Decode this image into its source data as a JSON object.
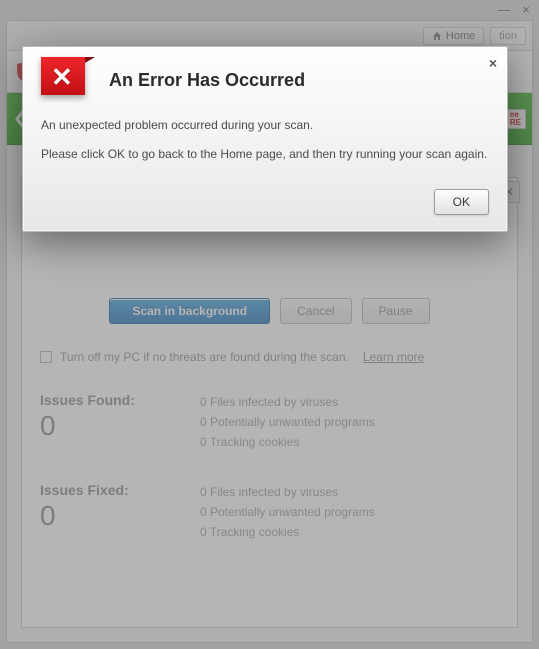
{
  "window": {
    "home_label": "Home",
    "tab_stub": "tion"
  },
  "greenbar": {
    "badge_line1": "ee",
    "badge_line2": "RE"
  },
  "scan_buttons": {
    "primary": "Scan in background",
    "cancel": "Cancel",
    "pause": "Pause"
  },
  "shutdown_row": {
    "label": "Turn off my PC if no threats are found during the scan.",
    "learn": "Learn more"
  },
  "found": {
    "title": "Issues Found:",
    "count": "0",
    "lines": [
      "0 Files infected by viruses",
      "0 Potentially unwanted programs",
      "0 Tracking cookies"
    ]
  },
  "fixed": {
    "title": "Issues Fixed:",
    "count": "0",
    "lines": [
      "0 Files infected by viruses",
      "0 Potentially unwanted programs",
      "0 Tracking cookies"
    ]
  },
  "dialog": {
    "title": "An Error Has Occurred",
    "line1": "An unexpected problem occurred during your scan.",
    "line2": "Please click OK to go back to the Home page, and then try running your scan again.",
    "ok": "OK"
  }
}
